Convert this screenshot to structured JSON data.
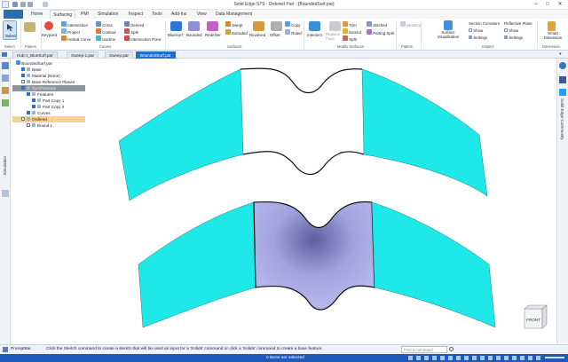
{
  "titlebar": {
    "title": "Solid Edge ST9 - Ordered Part - [BoundedSurf.par]",
    "minimize": "–",
    "maximize": "□",
    "close": "✕"
  },
  "tabs": [
    "Home",
    "Surfacing",
    "PMI",
    "Simulation",
    "Inspect",
    "Tools",
    "Add-Ins",
    "View",
    "Data Management"
  ],
  "ribbon": {
    "select": {
      "label": "Select",
      "group": "Select"
    },
    "planes": {
      "group": "Planes"
    },
    "curves": {
      "group": "Curves",
      "items": [
        "Keypoint",
        "Intersection",
        "Project",
        "Helical Curve",
        "Cross",
        "Contour",
        "Isocline",
        "Derived",
        "Split",
        "Intersection Point"
      ]
    },
    "surfaces": {
      "group": "Surfaces",
      "items": [
        "BlueSurf",
        "Bounded",
        "Redefine",
        "Swept",
        "Extruded",
        "Revolved",
        "Offset",
        "Copy",
        "Ruled"
      ]
    },
    "modify": {
      "group": "Modify Surfaces",
      "items": [
        "Intersect",
        "Replace Face",
        "Trim",
        "Extend",
        "Split",
        "Stitched",
        "Parting Split"
      ]
    },
    "pattern": {
      "group": "Pattern",
      "items": [
        "BlueDot"
      ]
    },
    "inspect": {
      "group": "Inspect",
      "items": [
        "Surface Visualization",
        "Section Curvature",
        "Show",
        "Settings",
        "Reflective Plane",
        "Show",
        "Settings"
      ]
    },
    "smart_dimension": {
      "label": "Smart Dimension",
      "group": "Dimension"
    }
  },
  "doctabs": [
    "Hub-1_BlueSurf.par",
    "Sweep-1.par",
    "Sweep.par",
    "BoundedSurf.par"
  ],
  "leftbar": {
    "label": "Simulation"
  },
  "tree": {
    "root": "BoundedSurf.par",
    "rows": [
      {
        "label": "Base",
        "indent": 1,
        "checked": true
      },
      {
        "label": "Material (None)",
        "indent": 1,
        "checked": true
      },
      {
        "label": "Base Reference Planes",
        "indent": 1,
        "checked": false
      },
      {
        "label": "Synchronous",
        "indent": 1,
        "checked": true
      },
      {
        "label": "Features",
        "indent": 2,
        "checked": true
      },
      {
        "label": "Part Copy 1",
        "indent": 3,
        "checked": true
      },
      {
        "label": "Part Copy 2",
        "indent": 3,
        "checked": true
      },
      {
        "label": "Curves",
        "indent": 2,
        "checked": true
      },
      {
        "label": "Ordered",
        "indent": 1,
        "checked": false
      },
      {
        "label": "Bound 1",
        "indent": 2,
        "checked": false
      }
    ]
  },
  "rightbar": {
    "label": "Solid Edge Community"
  },
  "viewcube": {
    "label": "FRONT"
  },
  "promptbar": {
    "label": "PromptBar",
    "message": "Click the Sketch command to create a sketch that will be used as input for a 'Solids' command or click a 'Solids' command to create a base feature.",
    "find_placeholder": "Find a command"
  },
  "statusbar": {
    "selection": "0 items are selected"
  },
  "colors": {
    "surface_cyan": "#1fe8e8",
    "bounded_surface": "#a7a8e3",
    "accent_blue": "#1e6fd0"
  }
}
